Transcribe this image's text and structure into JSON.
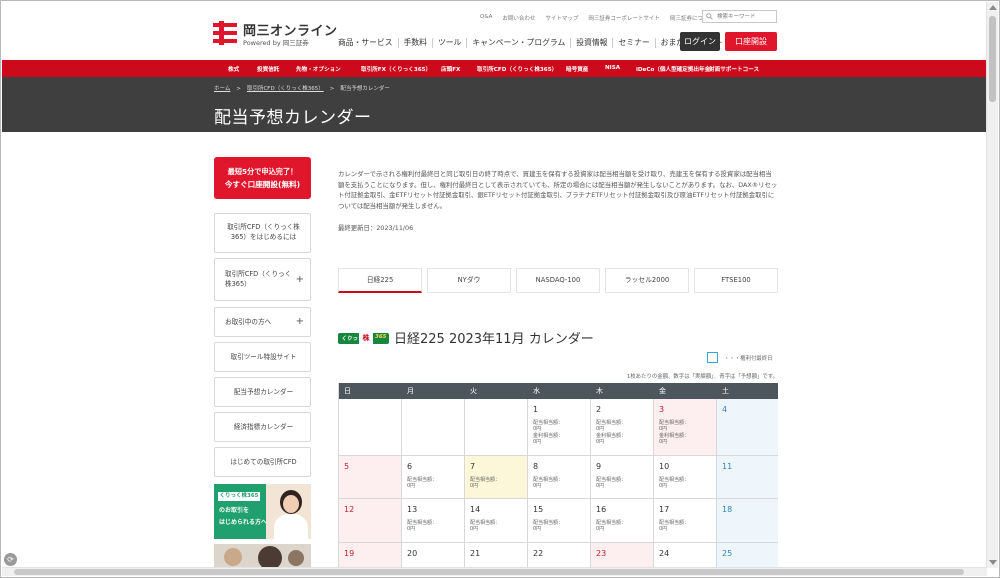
{
  "header": {
    "logo_name": "岡三オンライン",
    "logo_sub": "Powered by 岡三証券",
    "utility_links": [
      "Q&A",
      "お問い合わせ",
      "サイトマップ",
      "岡三証券コーポレートサイト",
      "岡三証券について"
    ],
    "search_placeholder": "検索キーワード",
    "main_nav": [
      "商品・サービス",
      "手数料",
      "ツール",
      "キャンペーン・プログラム",
      "投資情報",
      "セミナー",
      "おまかせサポート"
    ],
    "login_label": "ログイン",
    "open_account_label": "口座開設"
  },
  "product_nav": [
    "株式",
    "投資信託",
    "先物・オプション",
    "取引所FX（くりっく365）",
    "店頭FX",
    "取引所CFD（くりっく株365）",
    "暗号資産",
    "NISA",
    "iDeCo（個人型確定拠出年金）",
    "対面サポートコース"
  ],
  "breadcrumb": {
    "home": "ホーム",
    "parent": "取引所CFD（くりっく株365）",
    "current": "配当予想カレンダー"
  },
  "page_title": "配当予想カレンダー",
  "sidebar": {
    "cta_line1": "最短5分で申込完了！",
    "cta_line2": "今すぐ口座開設(無料)",
    "items": [
      {
        "label": "取引所CFD（くりっく株365）をはじめるには"
      },
      {
        "label": "取引所CFD（くりっく株365）"
      },
      {
        "label": "お取引中の方へ"
      },
      {
        "label": "取引ツール特設サイト"
      },
      {
        "label": "配当予想カレンダー"
      },
      {
        "label": "経済指標カレンダー"
      },
      {
        "label": "はじめての取引所CFD"
      }
    ],
    "banner_tag": "くりっく株365",
    "banner_line1": "のお取引を",
    "banner_line2": "はじめられる方へ"
  },
  "intro_text": "カレンダーで示される権利付最終日と同じ取引日の終了時点で、買建玉を保有する投資家は配当相当額を受け取り、売建玉を保有する投資家は配当相当額を支払うことになります。但し、権利付最終日として表示されていても、所定の場合には配当相当額が発生しないことがあります。なお、DAX®リセット付証拠金取引、金ETFリセット付証拠金取引、銀ETFリセット付証拠金取引、プラチナETFリセット付証拠金取引及び原油ETFリセット付証拠金取引については配当相当額が発生しません。",
  "last_updated": "最終更新日：2023/11/06",
  "tabs": [
    "日経225",
    "NYダウ",
    "NASDAQ-100",
    "ラッセル2000",
    "FTSE100"
  ],
  "calendar": {
    "badge_left": "くりっく",
    "badge_mid": "株",
    "badge_right": "365",
    "title": "日経225 2023年11月 カレンダー",
    "legend": "・・・権利付最終日",
    "unit_note": "1枚あたりの金額、数字は「実績額」、青字は「予想額」です。",
    "weekdays": [
      "日",
      "月",
      "火",
      "水",
      "木",
      "金",
      "土"
    ],
    "line_a": "配当相当額：",
    "line_a_val": "0円",
    "line_b": "金利相当額：",
    "line_b_val": "0円",
    "days": [
      {
        "day": "",
        "type": "blank",
        "lines": 0
      },
      {
        "day": "",
        "type": "blank",
        "lines": 0
      },
      {
        "day": "",
        "type": "blank",
        "lines": 0
      },
      {
        "day": "1",
        "type": "normal",
        "lines": 2
      },
      {
        "day": "2",
        "type": "normal",
        "lines": 2
      },
      {
        "day": "3",
        "type": "hol",
        "lines": 2
      },
      {
        "day": "4",
        "type": "sat",
        "lines": 0
      },
      {
        "day": "5",
        "type": "sun",
        "lines": 0
      },
      {
        "day": "6",
        "type": "normal",
        "lines": 1
      },
      {
        "day": "7",
        "type": "today",
        "lines": 1
      },
      {
        "day": "8",
        "type": "normal",
        "lines": 1
      },
      {
        "day": "9",
        "type": "normal",
        "lines": 1
      },
      {
        "day": "10",
        "type": "normal",
        "lines": 1
      },
      {
        "day": "11",
        "type": "sat",
        "lines": 0
      },
      {
        "day": "12",
        "type": "sun",
        "lines": 0
      },
      {
        "day": "13",
        "type": "normal",
        "lines": 1
      },
      {
        "day": "14",
        "type": "normal",
        "lines": 1
      },
      {
        "day": "15",
        "type": "normal",
        "lines": 1
      },
      {
        "day": "16",
        "type": "normal",
        "lines": 1
      },
      {
        "day": "17",
        "type": "normal",
        "lines": 1
      },
      {
        "day": "18",
        "type": "sat",
        "lines": 0
      },
      {
        "day": "19",
        "type": "sun",
        "lines": 0
      },
      {
        "day": "20",
        "type": "normal",
        "lines": 0
      },
      {
        "day": "21",
        "type": "normal",
        "lines": 0
      },
      {
        "day": "22",
        "type": "normal",
        "lines": 0
      },
      {
        "day": "23",
        "type": "hol",
        "lines": 0
      },
      {
        "day": "24",
        "type": "normal",
        "lines": 0
      },
      {
        "day": "25",
        "type": "sat",
        "lines": 0
      }
    ]
  },
  "colors": {
    "brand_red": "#cc0a1c",
    "cta_red": "#e0162d",
    "title_band": "#3f3f3f",
    "weekday_header": "#4d565c",
    "badge_green": "#17873f"
  }
}
